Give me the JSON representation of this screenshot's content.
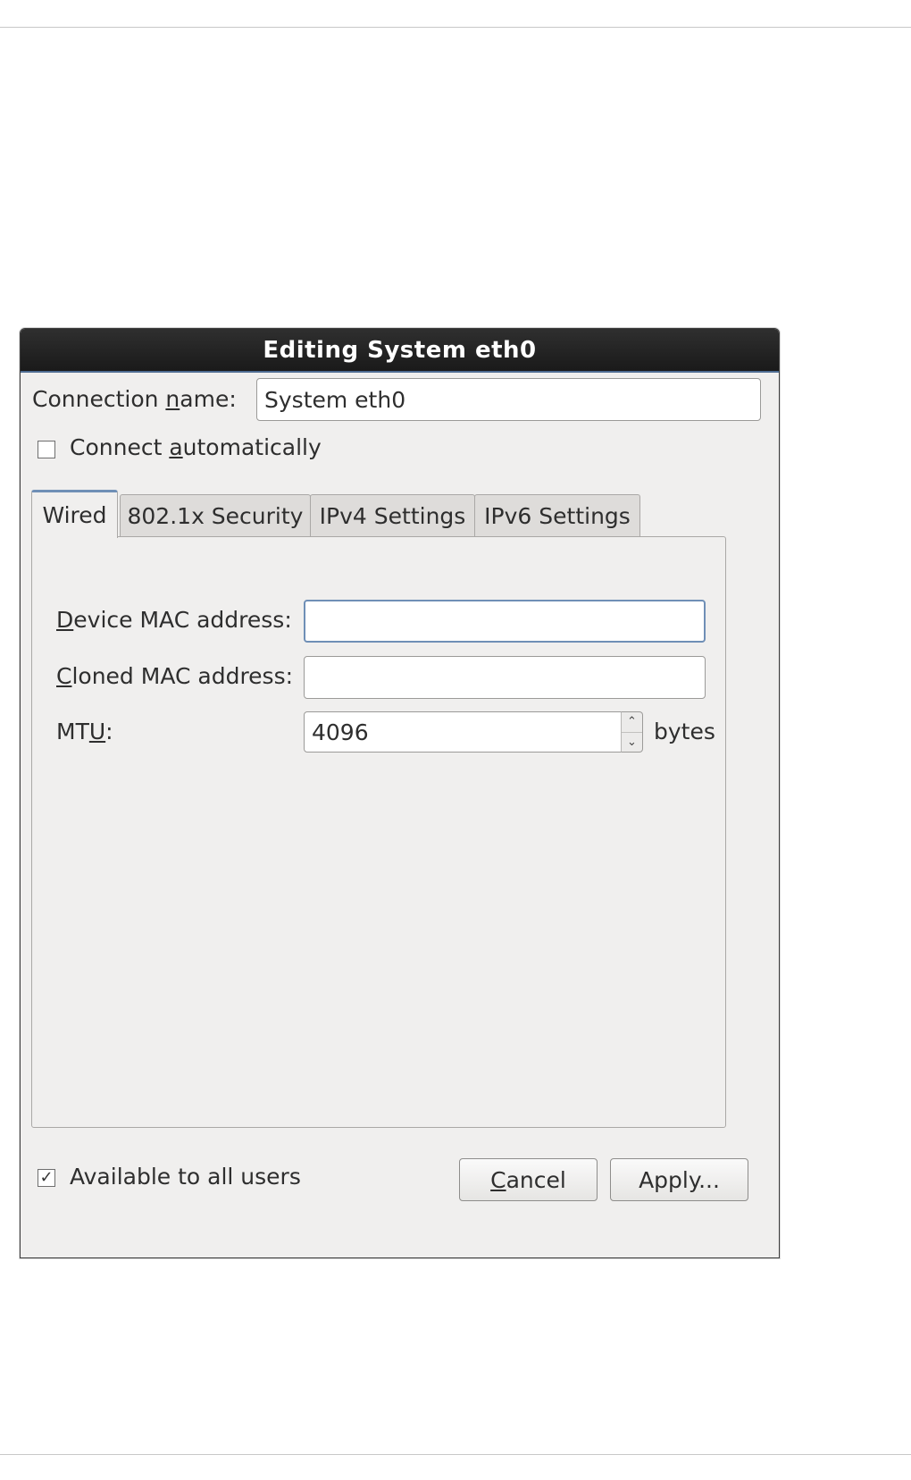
{
  "dialog": {
    "title": "Editing System eth0",
    "connection_name_label": "Connection name:",
    "connection_name_value": "System eth0",
    "connect_automatically_label": "Connect automatically",
    "connect_automatically_checked": false,
    "tabs": [
      {
        "label": "Wired",
        "active": true
      },
      {
        "label": "802.1x Security",
        "active": false
      },
      {
        "label": "IPv4 Settings",
        "active": false
      },
      {
        "label": "IPv6 Settings",
        "active": false
      }
    ],
    "wired": {
      "device_mac_label": "Device MAC address:",
      "device_mac_value": "",
      "cloned_mac_label": "Cloned MAC address:",
      "cloned_mac_value": "",
      "mtu_label": "MTU:",
      "mtu_value": "4096",
      "mtu_unit": "bytes"
    },
    "available_to_all_users_label": "Available to all users",
    "available_to_all_users_checked": true,
    "cancel_label": "Cancel",
    "apply_label": "Apply..."
  },
  "icons": {
    "checkbox_checked": "checkmark-icon",
    "spin_up": "chevron-up-icon",
    "spin_down": "chevron-down-icon"
  }
}
